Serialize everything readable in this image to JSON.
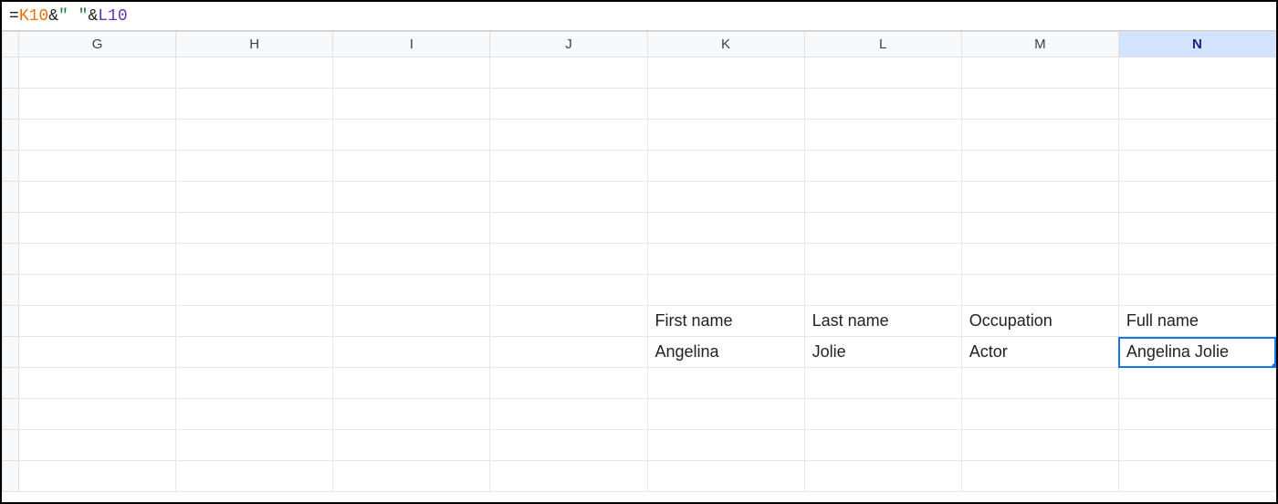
{
  "formula": {
    "eq": "=",
    "ref1": "K10",
    "amp1": "&",
    "str": "\"  \"",
    "amp2": "&",
    "ref2": "L10"
  },
  "columns": [
    "G",
    "H",
    "I",
    "J",
    "K",
    "L",
    "M",
    "N"
  ],
  "selected_column": "N",
  "active_cell": {
    "row": 10,
    "col": "N"
  },
  "rows_visible": 14,
  "cells": {
    "K9": "First name",
    "L9": "Last name",
    "M9": "Occupation",
    "N9": "Full name",
    "K10": "Angelina",
    "L10": "Jolie",
    "M10": "Actor",
    "N10": "Angelina Jolie"
  },
  "chart_data": {
    "type": "table",
    "title": "",
    "columns": [
      "First name",
      "Last name",
      "Occupation",
      "Full name"
    ],
    "rows": [
      [
        "Angelina",
        "Jolie",
        "Actor",
        "Angelina Jolie"
      ]
    ]
  }
}
